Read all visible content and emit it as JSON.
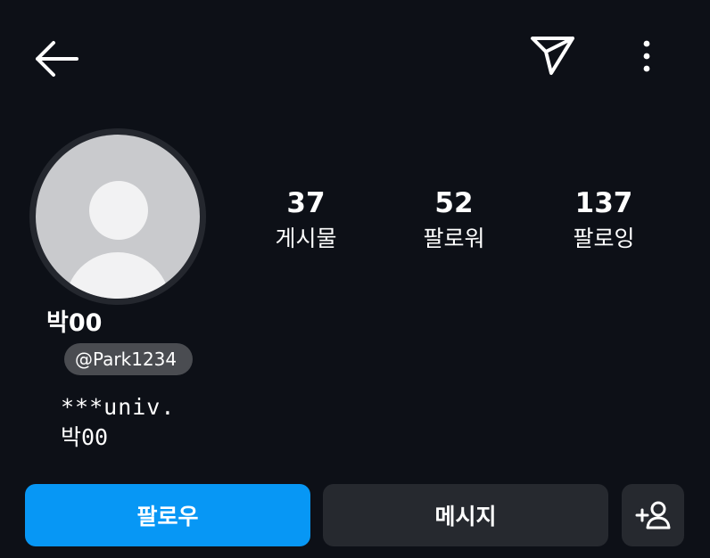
{
  "topbar": {
    "back_icon": "arrow-left-icon",
    "send_icon": "paper-plane-icon",
    "more_icon": "more-vertical-icon"
  },
  "profile": {
    "display_name": "박00",
    "username": "@Park1234",
    "bio": [
      "***univ.",
      "박00"
    ]
  },
  "stats": [
    {
      "value": "37",
      "label": "게시물"
    },
    {
      "value": "52",
      "label": "팔로워"
    },
    {
      "value": "137",
      "label": "팔로잉"
    }
  ],
  "actions": {
    "follow_label": "팔로우",
    "message_label": "메시지",
    "suggest_icon": "add-person-icon"
  },
  "colors": {
    "background": "#0d1017",
    "follow_button": "#0797f5",
    "secondary_button": "#26292f",
    "username_pill": "#4a4c51"
  }
}
